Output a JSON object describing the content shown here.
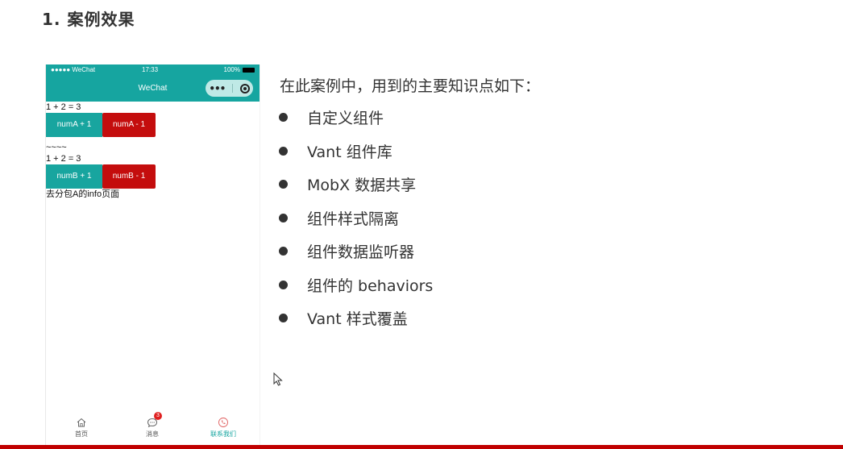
{
  "slide": {
    "title": "1. 案例效果"
  },
  "phone": {
    "status": {
      "left": "●●●●● WeChat",
      "time": "17:33",
      "battery": "100%"
    },
    "nav_title": "WeChat",
    "capsule": {
      "menu_icon": "more-dots-icon",
      "close_icon": "target-icon"
    },
    "body": {
      "sum_a": "1 + 2 = 3",
      "btn_a_plus": "numA + 1",
      "btn_a_minus": "numA - 1",
      "separator": "~~~~",
      "sum_b": "1 + 2 = 3",
      "btn_b_plus": "numB + 1",
      "btn_b_minus": "numB - 1",
      "link": "去分包A的info页面"
    },
    "tabbar": {
      "tabs": [
        {
          "label": "首页",
          "icon": "home-icon",
          "active": false
        },
        {
          "label": "消息",
          "icon": "message-icon",
          "badge": "3",
          "active": false
        },
        {
          "label": "联系我们",
          "icon": "phone-icon",
          "active": true
        }
      ]
    },
    "colors": {
      "header": "#16a5a0",
      "primary_button": "#18a59f",
      "danger_button": "#c40d0d"
    }
  },
  "content": {
    "intro": "在此案例中，用到的主要知识点如下：",
    "points": [
      "自定义组件",
      "Vant 组件库",
      "MobX 数据共享",
      "组件样式隔离",
      "组件数据监听器",
      "组件的 behaviors",
      "Vant 样式覆盖"
    ]
  }
}
